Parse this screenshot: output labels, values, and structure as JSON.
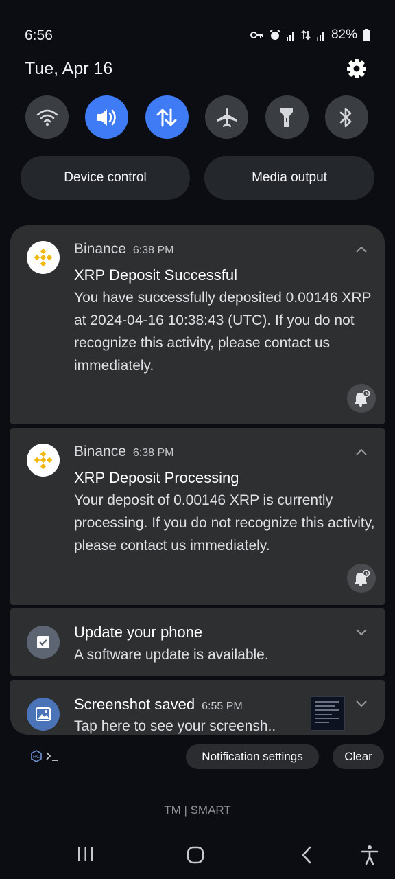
{
  "status_bar": {
    "time": "6:56",
    "battery": "82%"
  },
  "header": {
    "date": "Tue, Apr 16"
  },
  "quick_tiles": [
    {
      "icon": "wifi-icon",
      "active": false
    },
    {
      "icon": "sound-icon",
      "active": true
    },
    {
      "icon": "mobile-data-icon",
      "active": true
    },
    {
      "icon": "airplane-mode-icon",
      "active": false
    },
    {
      "icon": "flashlight-icon",
      "active": false
    },
    {
      "icon": "bluetooth-icon",
      "active": false
    }
  ],
  "controls": {
    "device_control": "Device control",
    "media_output": "Media output"
  },
  "notifications": [
    {
      "app": "Binance",
      "time": "6:38 PM",
      "title": "XRP Deposit Successful",
      "body": "You have successfully deposited 0.00146 XRP at 2024-04-16 10:38:43 (UTC). If you do not recognize this activity, please contact us immediately."
    },
    {
      "app": "Binance",
      "time": "6:38 PM",
      "title": "XRP Deposit Processing",
      "body": "Your deposit of 0.00146 XRP is currently processing. If you do not recognize this activity, please contact us immediately."
    },
    {
      "title": "Update your phone",
      "body": "A software update is available."
    },
    {
      "title": "Screenshot saved",
      "time": "6:55 PM",
      "body": "Tap here to see your screensh.."
    }
  ],
  "footer": {
    "notification_settings": "Notification settings",
    "clear": "Clear",
    "carrier": "TM | SMART"
  },
  "colors": {
    "accent": "#3e7bf5",
    "binance": "#f0b90b",
    "card": "#2e2f31"
  }
}
